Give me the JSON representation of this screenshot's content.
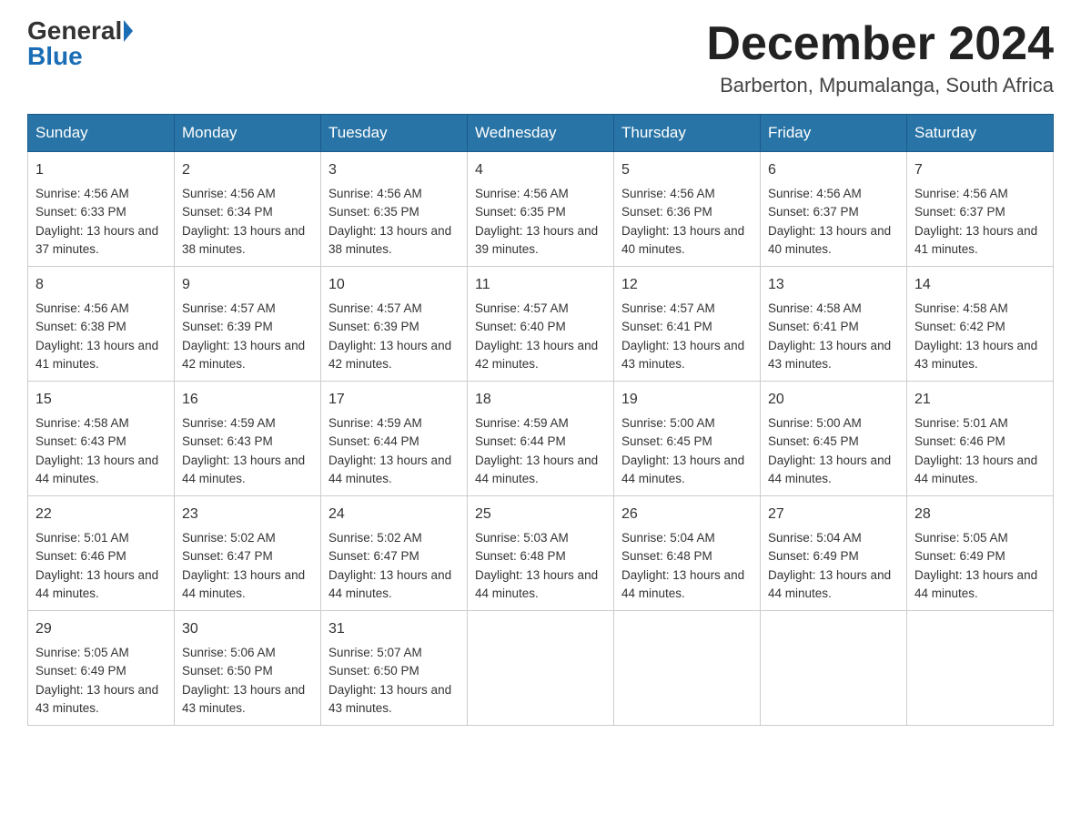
{
  "header": {
    "logo_general": "General",
    "logo_blue": "Blue",
    "month_title": "December 2024",
    "location": "Barberton, Mpumalanga, South Africa"
  },
  "days_of_week": [
    "Sunday",
    "Monday",
    "Tuesday",
    "Wednesday",
    "Thursday",
    "Friday",
    "Saturday"
  ],
  "weeks": [
    [
      {
        "day": 1,
        "sunrise": "4:56 AM",
        "sunset": "6:33 PM",
        "daylight": "13 hours and 37 minutes."
      },
      {
        "day": 2,
        "sunrise": "4:56 AM",
        "sunset": "6:34 PM",
        "daylight": "13 hours and 38 minutes."
      },
      {
        "day": 3,
        "sunrise": "4:56 AM",
        "sunset": "6:35 PM",
        "daylight": "13 hours and 38 minutes."
      },
      {
        "day": 4,
        "sunrise": "4:56 AM",
        "sunset": "6:35 PM",
        "daylight": "13 hours and 39 minutes."
      },
      {
        "day": 5,
        "sunrise": "4:56 AM",
        "sunset": "6:36 PM",
        "daylight": "13 hours and 40 minutes."
      },
      {
        "day": 6,
        "sunrise": "4:56 AM",
        "sunset": "6:37 PM",
        "daylight": "13 hours and 40 minutes."
      },
      {
        "day": 7,
        "sunrise": "4:56 AM",
        "sunset": "6:37 PM",
        "daylight": "13 hours and 41 minutes."
      }
    ],
    [
      {
        "day": 8,
        "sunrise": "4:56 AM",
        "sunset": "6:38 PM",
        "daylight": "13 hours and 41 minutes."
      },
      {
        "day": 9,
        "sunrise": "4:57 AM",
        "sunset": "6:39 PM",
        "daylight": "13 hours and 42 minutes."
      },
      {
        "day": 10,
        "sunrise": "4:57 AM",
        "sunset": "6:39 PM",
        "daylight": "13 hours and 42 minutes."
      },
      {
        "day": 11,
        "sunrise": "4:57 AM",
        "sunset": "6:40 PM",
        "daylight": "13 hours and 42 minutes."
      },
      {
        "day": 12,
        "sunrise": "4:57 AM",
        "sunset": "6:41 PM",
        "daylight": "13 hours and 43 minutes."
      },
      {
        "day": 13,
        "sunrise": "4:58 AM",
        "sunset": "6:41 PM",
        "daylight": "13 hours and 43 minutes."
      },
      {
        "day": 14,
        "sunrise": "4:58 AM",
        "sunset": "6:42 PM",
        "daylight": "13 hours and 43 minutes."
      }
    ],
    [
      {
        "day": 15,
        "sunrise": "4:58 AM",
        "sunset": "6:43 PM",
        "daylight": "13 hours and 44 minutes."
      },
      {
        "day": 16,
        "sunrise": "4:59 AM",
        "sunset": "6:43 PM",
        "daylight": "13 hours and 44 minutes."
      },
      {
        "day": 17,
        "sunrise": "4:59 AM",
        "sunset": "6:44 PM",
        "daylight": "13 hours and 44 minutes."
      },
      {
        "day": 18,
        "sunrise": "4:59 AM",
        "sunset": "6:44 PM",
        "daylight": "13 hours and 44 minutes."
      },
      {
        "day": 19,
        "sunrise": "5:00 AM",
        "sunset": "6:45 PM",
        "daylight": "13 hours and 44 minutes."
      },
      {
        "day": 20,
        "sunrise": "5:00 AM",
        "sunset": "6:45 PM",
        "daylight": "13 hours and 44 minutes."
      },
      {
        "day": 21,
        "sunrise": "5:01 AM",
        "sunset": "6:46 PM",
        "daylight": "13 hours and 44 minutes."
      }
    ],
    [
      {
        "day": 22,
        "sunrise": "5:01 AM",
        "sunset": "6:46 PM",
        "daylight": "13 hours and 44 minutes."
      },
      {
        "day": 23,
        "sunrise": "5:02 AM",
        "sunset": "6:47 PM",
        "daylight": "13 hours and 44 minutes."
      },
      {
        "day": 24,
        "sunrise": "5:02 AM",
        "sunset": "6:47 PM",
        "daylight": "13 hours and 44 minutes."
      },
      {
        "day": 25,
        "sunrise": "5:03 AM",
        "sunset": "6:48 PM",
        "daylight": "13 hours and 44 minutes."
      },
      {
        "day": 26,
        "sunrise": "5:04 AM",
        "sunset": "6:48 PM",
        "daylight": "13 hours and 44 minutes."
      },
      {
        "day": 27,
        "sunrise": "5:04 AM",
        "sunset": "6:49 PM",
        "daylight": "13 hours and 44 minutes."
      },
      {
        "day": 28,
        "sunrise": "5:05 AM",
        "sunset": "6:49 PM",
        "daylight": "13 hours and 44 minutes."
      }
    ],
    [
      {
        "day": 29,
        "sunrise": "5:05 AM",
        "sunset": "6:49 PM",
        "daylight": "13 hours and 43 minutes."
      },
      {
        "day": 30,
        "sunrise": "5:06 AM",
        "sunset": "6:50 PM",
        "daylight": "13 hours and 43 minutes."
      },
      {
        "day": 31,
        "sunrise": "5:07 AM",
        "sunset": "6:50 PM",
        "daylight": "13 hours and 43 minutes."
      },
      null,
      null,
      null,
      null
    ]
  ]
}
